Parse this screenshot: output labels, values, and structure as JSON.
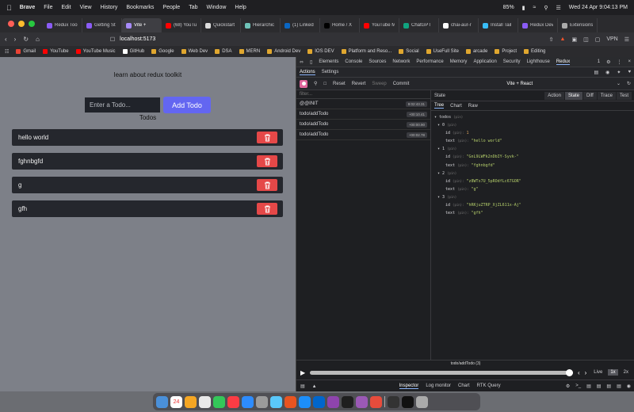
{
  "menubar": {
    "app": "Brave",
    "items": [
      "File",
      "Edit",
      "View",
      "History",
      "Bookmarks",
      "People",
      "Tab",
      "Window",
      "Help"
    ],
    "battery": "85%",
    "datetime": "Wed 24 Apr  9:04:13 PM"
  },
  "tabs": [
    {
      "label": "Redux Tool",
      "color": "#8b5cf6"
    },
    {
      "label": "Getting St",
      "color": "#8b5cf6"
    },
    {
      "label": "Vite +",
      "color": "#a78bfa",
      "active": true
    },
    {
      "label": "(68) YouTu",
      "color": "#ff0000"
    },
    {
      "label": "Quickstart",
      "color": "#dddddd"
    },
    {
      "label": "Hierarchic",
      "color": "#6fc3b8"
    },
    {
      "label": "(1) Linked",
      "color": "#0a66c2"
    },
    {
      "label": "Home / X",
      "color": "#000000"
    },
    {
      "label": "YouTube M",
      "color": "#ff0000"
    },
    {
      "label": "ChatGPT",
      "color": "#10a37f"
    },
    {
      "label": "chai-aur-r",
      "color": "#ffffff"
    },
    {
      "label": "Install Tail",
      "color": "#38bdf8"
    },
    {
      "label": "Redux Dev",
      "color": "#8b5cf6"
    },
    {
      "label": "Extensions",
      "color": "#aaaaaa"
    }
  ],
  "address": {
    "url": "localhost:5173",
    "vpn": "VPN"
  },
  "bookmarks": [
    {
      "label": "Gmail",
      "color": "#ea4335"
    },
    {
      "label": "YouTube",
      "color": "#ff0000"
    },
    {
      "label": "YouTube Music",
      "color": "#ff0000"
    },
    {
      "label": "GitHub",
      "color": "#ffffff"
    },
    {
      "label": "Google",
      "color": "#e0a72f"
    },
    {
      "label": "Web Dev",
      "color": "#e0a72f"
    },
    {
      "label": "DSA",
      "color": "#e0a72f"
    },
    {
      "label": "MERN",
      "color": "#e0a72f"
    },
    {
      "label": "Android Dev",
      "color": "#e0a72f"
    },
    {
      "label": "IOS DEV",
      "color": "#e0a72f"
    },
    {
      "label": "Platform and Reso...",
      "color": "#e0a72f"
    },
    {
      "label": "Social",
      "color": "#e0a72f"
    },
    {
      "label": "UseFull Site",
      "color": "#e0a72f"
    },
    {
      "label": "arcade",
      "color": "#e0a72f"
    },
    {
      "label": "Project",
      "color": "#e0a72f"
    },
    {
      "label": "Editing",
      "color": "#e0a72f"
    }
  ],
  "app": {
    "title": "learn about redux toolkit",
    "input_placeholder": "Enter a Todo...",
    "add_label": "Add Todo",
    "todos_label": "Todos",
    "todos": [
      "hello world",
      "fghnbgfd",
      "g",
      "gfh"
    ]
  },
  "devtools": {
    "tabs": [
      "Elements",
      "Console",
      "Sources",
      "Network",
      "Performance",
      "Memory",
      "Application",
      "Security",
      "Lighthouse",
      "Redux"
    ],
    "active_tab": "Redux",
    "issues": "1",
    "redux_tabs": [
      "Actions",
      "Settings"
    ],
    "toolbar": [
      "Reset",
      "Revert",
      "Sweep",
      "Commit"
    ],
    "instance": "Vite + React",
    "filter_placeholder": "filter...",
    "actions": [
      {
        "type": "@@INIT",
        "time": "9:02:43.31"
      },
      {
        "type": "todo/addTodo",
        "time": "+00:10.41"
      },
      {
        "type": "todo/addTodo",
        "time": "+00:00.90"
      },
      {
        "type": "todo/addTodo",
        "time": "+00:02.78"
      }
    ],
    "state_label": "State",
    "view_modes": [
      "Action",
      "State",
      "Diff",
      "Trace",
      "Test"
    ],
    "active_view": "State",
    "sub_tabs": [
      "Tree",
      "Chart",
      "Raw"
    ],
    "active_sub": "Tree",
    "tree": {
      "root": "todos",
      "root_type": "(pin)",
      "items": [
        {
          "index": "0",
          "id": "1",
          "text": "\"hello world\""
        },
        {
          "index": "1",
          "id": "\"GnL9LWFk2nDbIY-Syvk-\"",
          "text": "\"fghnbgfd\""
        },
        {
          "index": "2",
          "id": "\"z8WTx7U_5pROdfLc67GOR\"",
          "text": "\"g\""
        },
        {
          "index": "3",
          "id": "\"hRKjuZTRP_XjZL611x-Aj\"",
          "text": "\"gfh\""
        }
      ]
    },
    "slider_label": "todo/addTodo (3)",
    "speeds": [
      "Live",
      "1x",
      "2x"
    ],
    "active_speed": "1x",
    "monitors": [
      "Inspector",
      "Log monitor",
      "Chart",
      "RTK Query"
    ],
    "active_monitor": "Inspector"
  },
  "dock": {
    "calendar_day": "24",
    "apps": [
      "#4a90d9",
      "#ffffff",
      "#f5a623",
      "#e8e8e8",
      "#34c759",
      "#fc3c44",
      "#2d8cff",
      "#9b9b9b",
      "#5ac8fa",
      "#e95420",
      "#1c8ef9",
      "#0066cc",
      "#8e44ad",
      "#1f1f1f",
      "#9b59b6",
      "#e74c3c",
      "#333333",
      "#111111",
      "#aaaaaa"
    ]
  }
}
